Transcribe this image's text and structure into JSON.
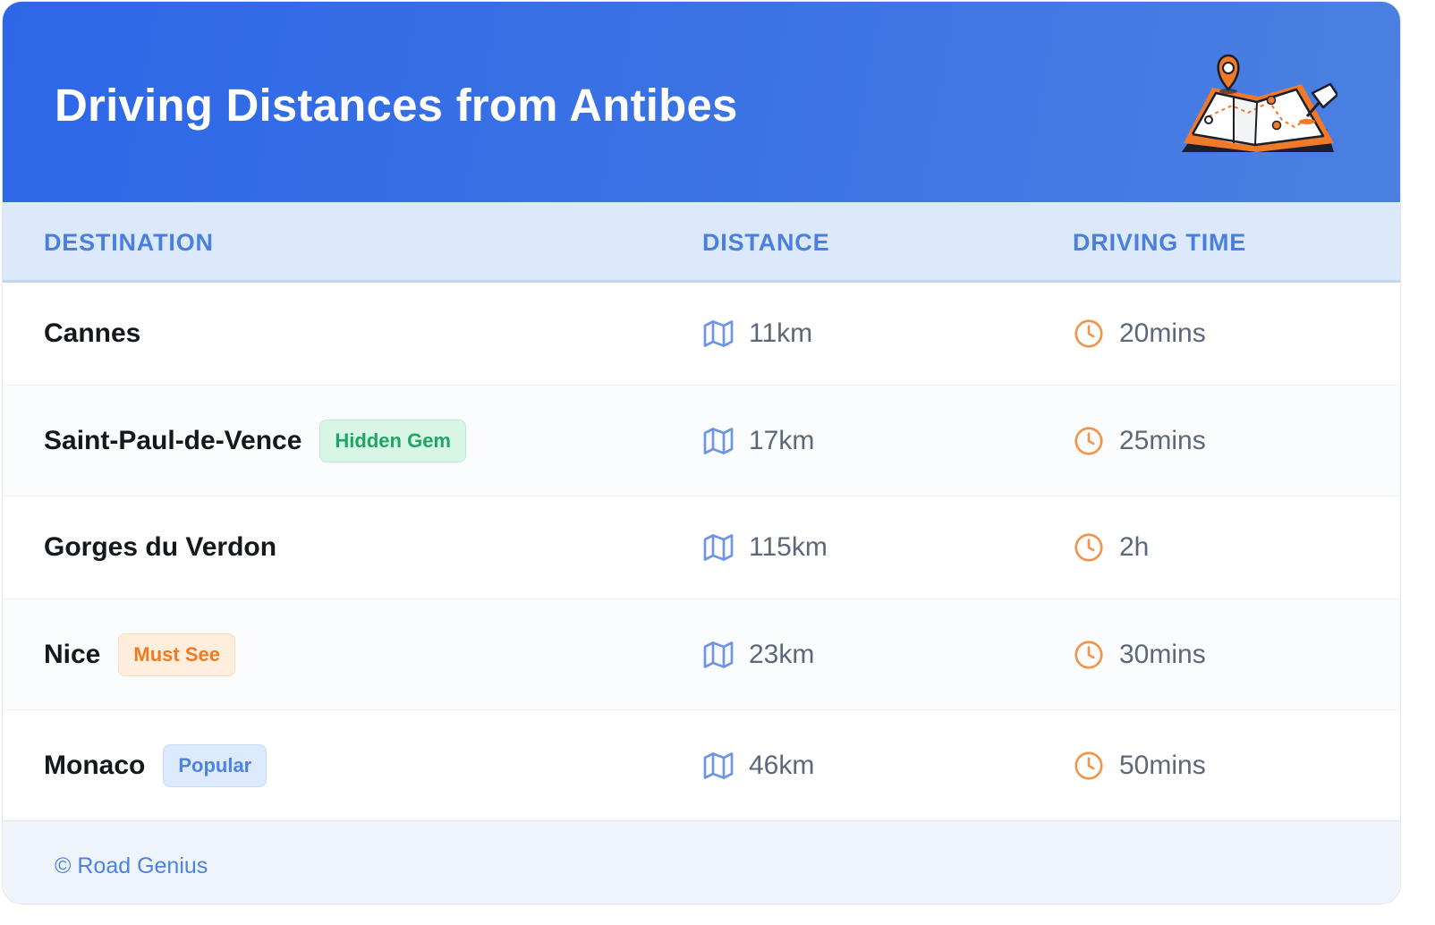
{
  "header": {
    "title": "Driving Distances from Antibes",
    "illustration_icon": "folded-map-with-pins-icon"
  },
  "table": {
    "columns": [
      "DESTINATION",
      "DISTANCE",
      "DRIVING TIME"
    ],
    "distance_icon": "map-icon",
    "time_icon": "clock-icon",
    "rows": [
      {
        "destination": "Cannes",
        "badge": null,
        "distance": "11km",
        "time": "20mins"
      },
      {
        "destination": "Saint-Paul-de-Vence",
        "badge": {
          "label": "Hidden Gem",
          "color": "#21a565"
        },
        "distance": "17km",
        "time": "25mins"
      },
      {
        "destination": "Gorges du Verdon",
        "badge": null,
        "distance": "115km",
        "time": "2h"
      },
      {
        "destination": "Nice",
        "badge": {
          "label": "Must See",
          "color": "#ef7a1f"
        },
        "distance": "23km",
        "time": "30mins"
      },
      {
        "destination": "Monaco",
        "badge": {
          "label": "Popular",
          "color": "#4f83e0"
        },
        "distance": "46km",
        "time": "50mins"
      }
    ]
  },
  "footer": {
    "text": "© Road Genius"
  },
  "colors": {
    "header_bg": "#2d67e8",
    "header_text": "#ffffff",
    "column_header_bg": "#dce9fd",
    "column_header_text": "#4a7fe0",
    "map_icon": "#6f95e6",
    "clock_icon": "#f0964c",
    "accent_orange": "#f07a2a"
  }
}
